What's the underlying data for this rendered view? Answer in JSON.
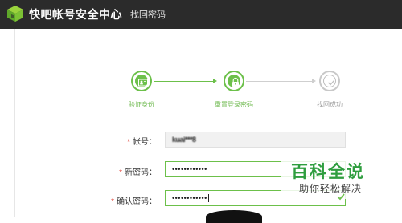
{
  "header": {
    "brand": "快吧帐号安全中心",
    "page_title": "找回密码"
  },
  "steps": [
    {
      "label": "验证身份",
      "status": "done",
      "icon": "id-card-icon"
    },
    {
      "label": "重置登录密码",
      "status": "current",
      "icon": "lock-icon"
    },
    {
      "label": "找回成功",
      "status": "pending",
      "icon": "check-icon"
    }
  ],
  "form": {
    "account": {
      "label": "帐号：",
      "required_mark": "*",
      "value": "kuai***8"
    },
    "new_password": {
      "label": "新密码：",
      "required_mark": "*",
      "value": "••••••••••••"
    },
    "confirm_password": {
      "label": "确认密码：",
      "required_mark": "*",
      "value": "••••••••••••"
    }
  },
  "watermark": {
    "title": "百科全说",
    "subtitle": "助你轻松解决"
  },
  "colors": {
    "accent": "#6cc04a",
    "header_bg": "#2b2b2b",
    "required": "#e0463c"
  }
}
